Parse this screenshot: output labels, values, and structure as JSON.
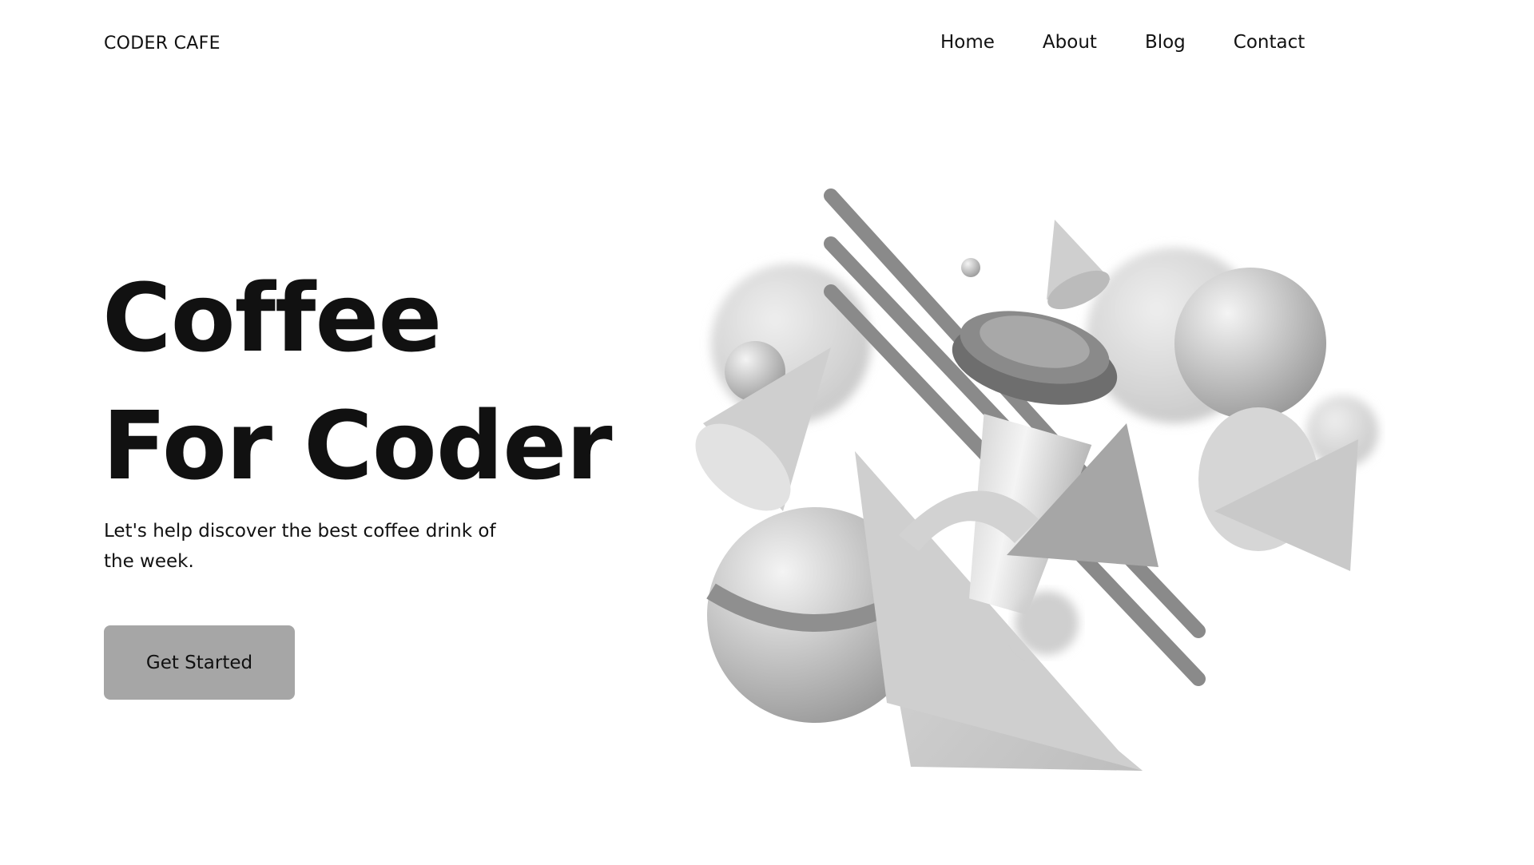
{
  "header": {
    "logo": "CODER CAFE",
    "nav": [
      "Home",
      "About",
      "Blog",
      "Contact"
    ]
  },
  "hero": {
    "title_line1": "Coffee",
    "title_line2": "For Coder",
    "subtitle": "Let's help discover the best coffee drink of the week.",
    "cta_label": "Get Started"
  }
}
